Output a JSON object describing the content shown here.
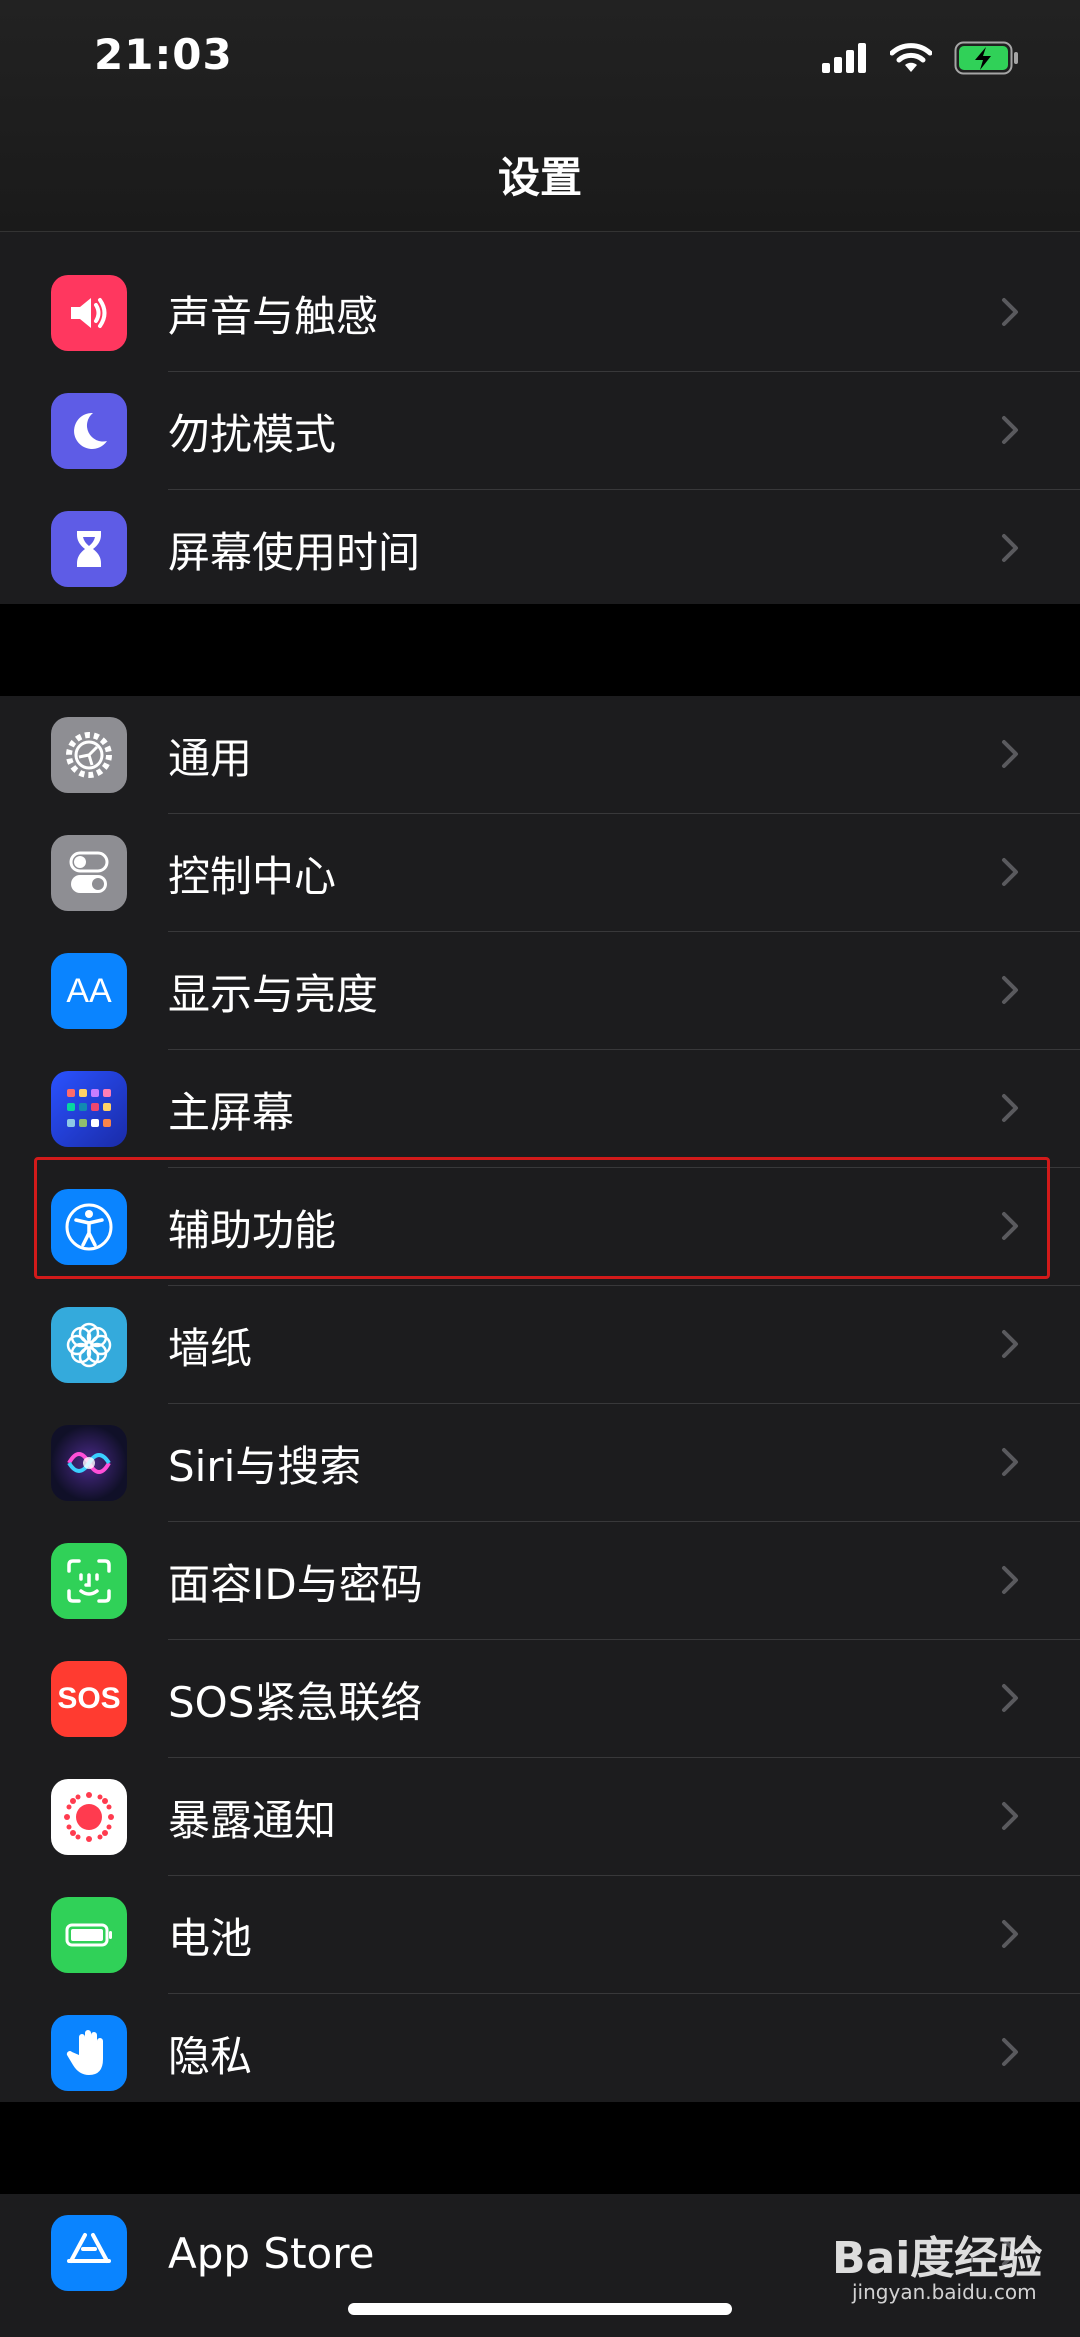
{
  "status": {
    "time": "21:03"
  },
  "nav": {
    "title": "设置"
  },
  "group1": [
    {
      "label": "声音与触感",
      "icon": "speaker-icon",
      "color": "#ff375f"
    },
    {
      "label": "勿扰模式",
      "icon": "moon-icon",
      "color": "#5e5ce6"
    },
    {
      "label": "屏幕使用时间",
      "icon": "hourglass-icon",
      "color": "#5e5ce6"
    }
  ],
  "group2": [
    {
      "label": "通用",
      "icon": "gear-icon",
      "color": "#8e8e93"
    },
    {
      "label": "控制中心",
      "icon": "toggles-icon",
      "color": "#8e8e93"
    },
    {
      "label": "显示与亮度",
      "icon": "text-size-icon",
      "color": "#0a84ff"
    },
    {
      "label": "主屏幕",
      "icon": "home-grid-icon",
      "color": "#0a4fff"
    },
    {
      "label": "辅助功能",
      "icon": "accessibility-icon",
      "color": "#0a84ff"
    },
    {
      "label": "墙纸",
      "icon": "flower-icon",
      "color": "#34aadc"
    },
    {
      "label": "Siri与搜索",
      "icon": "siri-icon",
      "color": "#1b1b3a"
    },
    {
      "label": "面容ID与密码",
      "icon": "face-id-icon",
      "color": "#30d158"
    },
    {
      "label": "SOS紧急联络",
      "icon": "sos-icon",
      "color": "#ff3b30"
    },
    {
      "label": "暴露通知",
      "icon": "exposure-icon",
      "color": "#ffffff"
    },
    {
      "label": "电池",
      "icon": "battery-icon",
      "color": "#30d158"
    },
    {
      "label": "隐私",
      "icon": "hand-icon",
      "color": "#0a84ff"
    }
  ],
  "group3": [
    {
      "label": "App Store",
      "icon": "app-store-icon",
      "color": "#0a84ff"
    }
  ],
  "sos_text": "SOS",
  "aa_text": "AA",
  "watermark": {
    "brand": "Bai度经验",
    "url": "jingyan.baidu.com"
  }
}
